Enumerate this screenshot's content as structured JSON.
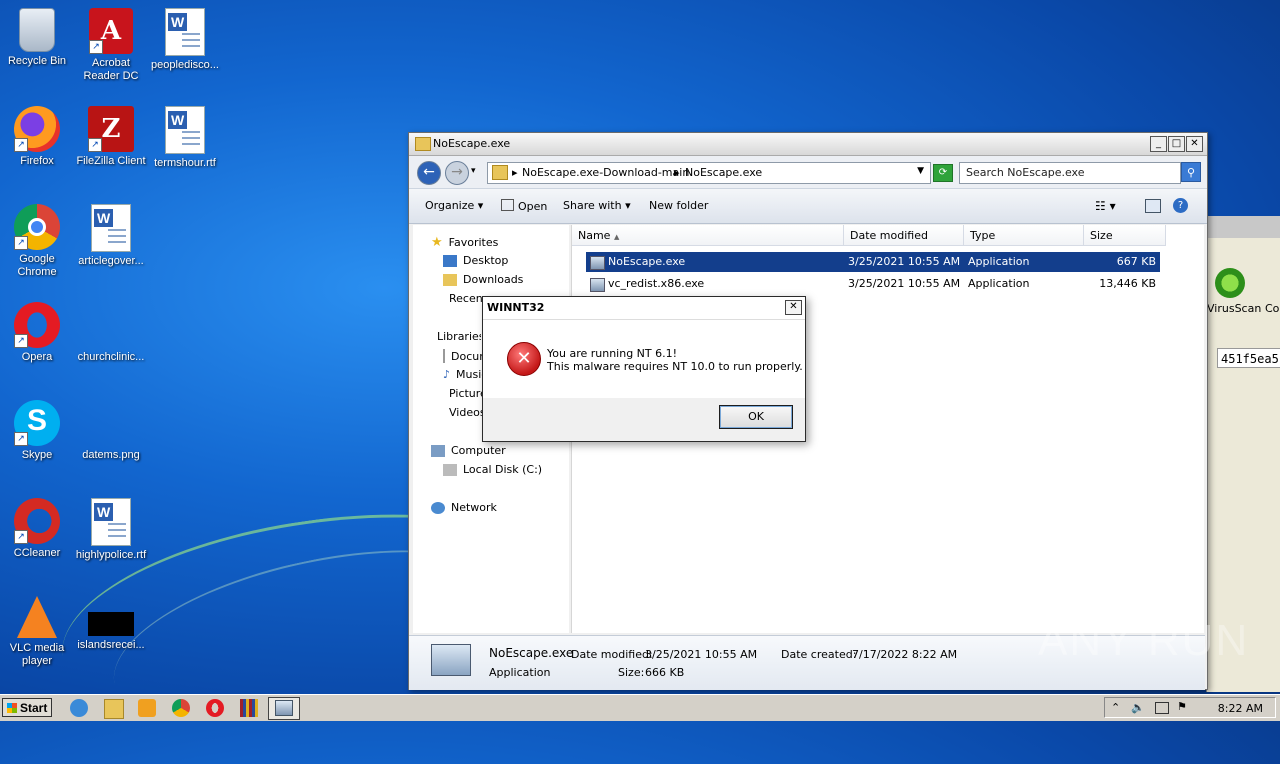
{
  "desktop": {
    "icons": [
      {
        "label": "Recycle Bin",
        "icon": "recycle-bin-icon"
      },
      {
        "label": "Acrobat Reader DC",
        "icon": "acrobat-icon"
      },
      {
        "label": "peopledisco...",
        "icon": "word-document-icon"
      },
      {
        "label": "Firefox",
        "icon": "firefox-icon"
      },
      {
        "label": "FileZilla Client",
        "icon": "filezilla-icon"
      },
      {
        "label": "termshour.rtf",
        "icon": "word-document-icon"
      },
      {
        "label": "Google Chrome",
        "icon": "chrome-icon"
      },
      {
        "label": "articlegover...",
        "icon": "word-document-icon"
      },
      {
        "label": "Opera",
        "icon": "opera-icon"
      },
      {
        "label": "churchclinic...",
        "icon": "blank-file-icon"
      },
      {
        "label": "Skype",
        "icon": "skype-icon"
      },
      {
        "label": "datems.png",
        "icon": "blank-file-icon"
      },
      {
        "label": "CCleaner",
        "icon": "ccleaner-icon"
      },
      {
        "label": "highlypolice.rtf",
        "icon": "word-document-icon"
      },
      {
        "label": "VLC media player",
        "icon": "vlc-icon"
      },
      {
        "label": "islandsrecei...",
        "icon": "black-image-icon"
      }
    ]
  },
  "explorer": {
    "title": "NoEscape.exe",
    "breadcrumb": [
      "NoEscape.exe-Download-main",
      "NoEscape.exe"
    ],
    "search_placeholder": "Search NoEscape.exe",
    "commands": {
      "organize": "Organize",
      "open": "Open",
      "share_with": "Share with",
      "new_folder": "New folder"
    },
    "nav": {
      "favorites": "Favorites",
      "desktop": "Desktop",
      "downloads": "Downloads",
      "recent": "Recent Places",
      "libraries": "Libraries",
      "documents": "Documents",
      "music": "Music",
      "pictures": "Pictures",
      "videos": "Videos",
      "computer": "Computer",
      "local_disk": "Local Disk (C:)",
      "network": "Network"
    },
    "columns": {
      "name": "Name",
      "date": "Date modified",
      "type": "Type",
      "size": "Size"
    },
    "files": [
      {
        "name": "NoEscape.exe",
        "date": "3/25/2021 10:55 AM",
        "type": "Application",
        "size": "667 KB"
      },
      {
        "name": "vc_redist.x86.exe",
        "date": "3/25/2021 10:55 AM",
        "type": "Application",
        "size": "13,446 KB"
      }
    ],
    "details": {
      "name": "NoEscape.exe",
      "type": "Application",
      "date_modified_label": "Date modified:",
      "date_modified": "3/25/2021 10:55 AM",
      "date_created_label": "Date created:",
      "date_created": "7/17/2022 8:22 AM",
      "size_label": "Size:",
      "size": "666 KB"
    }
  },
  "dialog": {
    "title": "WINNT32",
    "line1": "You are running NT 6.1!",
    "line2": "This malware requires NT 10.0 to run properly.",
    "ok": "OK"
  },
  "bg_window": {
    "virusscan": "VirusScan",
    "cont": "Con",
    "hash": "451f5ea5"
  },
  "taskbar": {
    "start": "Start",
    "clock": "8:22 AM"
  },
  "watermark": "ANY RUN"
}
